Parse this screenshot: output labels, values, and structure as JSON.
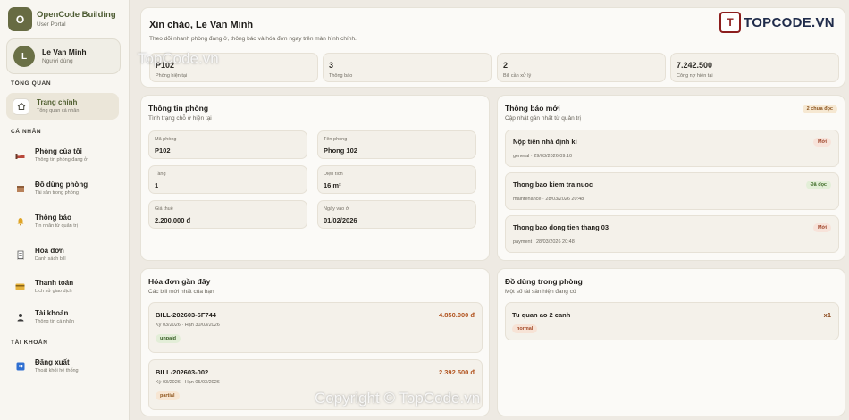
{
  "brand": {
    "logo_letter": "O",
    "name": "OpenCode Building",
    "subtitle": "User Portal"
  },
  "user": {
    "initial": "L",
    "name": "Le Van Minh",
    "role": "Người dùng"
  },
  "sections": {
    "overview": "TỔNG QUAN",
    "personal": "CÁ NHÂN",
    "account": "TÀI KHOẢN"
  },
  "nav": [
    {
      "title": "Trang chính",
      "sub": "Tổng quan cá nhân",
      "icon": "home-icon"
    },
    {
      "title": "Phòng của tôi",
      "sub": "Thông tin phòng đang ở",
      "icon": "bed-icon"
    },
    {
      "title": "Đồ dùng phòng",
      "sub": "Tài sản trong phòng",
      "icon": "box-icon"
    },
    {
      "title": "Thông báo",
      "sub": "Tin nhắn từ quản trị",
      "icon": "bell-icon"
    },
    {
      "title": "Hóa đơn",
      "sub": "Danh sách bill",
      "icon": "receipt-icon"
    },
    {
      "title": "Thanh toán",
      "sub": "Lịch sử giao dịch",
      "icon": "card-icon"
    },
    {
      "title": "Tài khoản",
      "sub": "Thông tin cá nhân",
      "icon": "user-icon"
    },
    {
      "title": "Đăng xuất",
      "sub": "Thoát khỏi hệ thống",
      "icon": "logout-icon"
    }
  ],
  "header": {
    "greeting": "Xin chào, Le Van Minh",
    "subtitle": "Theo dõi nhanh phòng đang ở, thông báo và hóa đơn ngay trên màn hình chính.",
    "stats": [
      {
        "value": "P102",
        "label": "Phòng hiện tại"
      },
      {
        "value": "3",
        "label": "Thông báo"
      },
      {
        "value": "2",
        "label": "Bill cần xử lý"
      },
      {
        "value": "7.242.500",
        "label": "Công nợ hiện tại"
      }
    ]
  },
  "room": {
    "title": "Thông tin phòng",
    "subtitle": "Tình trạng chỗ ở hiện tại",
    "fields": [
      {
        "label": "Mã phòng",
        "value": "P102"
      },
      {
        "label": "Tên phòng",
        "value": "Phong 102"
      },
      {
        "label": "Tầng",
        "value": "1"
      },
      {
        "label": "Diện tích",
        "value": "16 m²"
      },
      {
        "label": "Giá thuê",
        "value": "2.200.000 đ"
      },
      {
        "label": "Ngày vào ở",
        "value": "01/02/2026"
      }
    ]
  },
  "notices": {
    "title": "Thông báo mới",
    "subtitle": "Cập nhật gần nhất từ quản trị",
    "badge": "2 chưa đọc",
    "items": [
      {
        "title": "Nộp tiền nhà định kì",
        "meta": "general · 29/03/2026 09:10",
        "status": "Mới"
      },
      {
        "title": "Thong bao kiem tra nuoc",
        "meta": "maintenance · 28/03/2026 20:48",
        "status": "Đã đọc"
      },
      {
        "title": "Thong bao dong tien thang 03",
        "meta": "payment · 28/03/2026 20:48",
        "status": "Mới"
      }
    ]
  },
  "bills": {
    "title": "Hóa đơn gần đây",
    "subtitle": "Các bill mới nhất của bạn",
    "items": [
      {
        "code": "BILL-202603-6F744",
        "period": "Kỳ 03/2026 · Hạn 30/03/2026",
        "amount": "4.850.000 đ",
        "status": "unpaid"
      },
      {
        "code": "BILL-202603-002",
        "period": "Kỳ 03/2026 · Hạn 05/03/2026",
        "amount": "2.392.500 đ",
        "status": "partial"
      }
    ]
  },
  "items": {
    "title": "Đồ dùng trong phòng",
    "subtitle": "Một số tài sản hiện đang có",
    "list": [
      {
        "name": "Tu quan ao 2 canh",
        "qty": "x1",
        "condition": "normal"
      }
    ]
  },
  "watermarks": {
    "logo_text": "TOPCODE.VN",
    "tl": "TopCode.vn",
    "bottom": "Copyright © TopCode.vn"
  },
  "colors": {
    "accent": "#4f5e2f",
    "amount": "#b25521",
    "sidebar_bg": "#f8f6f1"
  }
}
